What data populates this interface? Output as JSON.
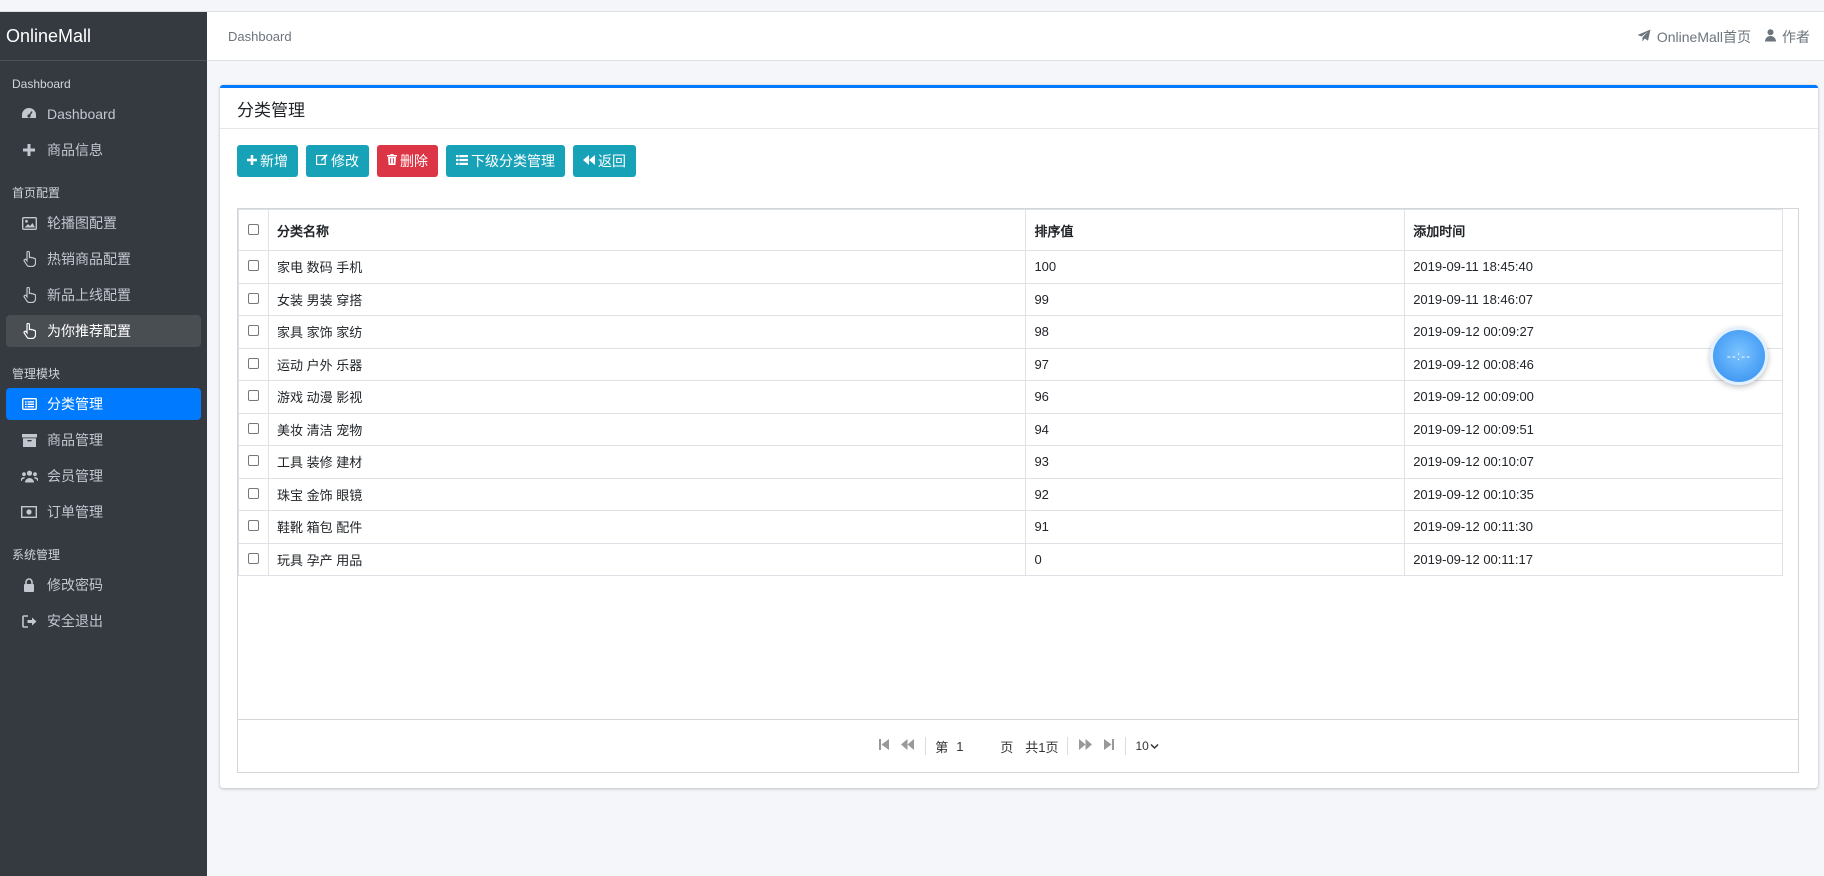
{
  "brand": "OnlineMall",
  "sidebar": {
    "sections": [
      {
        "header": "Dashboard",
        "items": [
          {
            "label": "Dashboard",
            "icon": "dashboard-icon"
          },
          {
            "label": "商品信息",
            "icon": "plus-icon"
          }
        ]
      },
      {
        "header": "首页配置",
        "items": [
          {
            "label": "轮播图配置",
            "icon": "image-icon"
          },
          {
            "label": "热销商品配置",
            "icon": "hand-pointer-icon"
          },
          {
            "label": "新品上线配置",
            "icon": "hand-pointer-icon"
          },
          {
            "label": "为你推荐配置",
            "icon": "hand-pointer-icon"
          }
        ]
      },
      {
        "header": "管理模块",
        "items": [
          {
            "label": "分类管理",
            "icon": "list-alt-icon"
          },
          {
            "label": "商品管理",
            "icon": "archive-icon"
          },
          {
            "label": "会员管理",
            "icon": "users-icon"
          },
          {
            "label": "订单管理",
            "icon": "money-icon"
          }
        ]
      },
      {
        "header": "系统管理",
        "items": [
          {
            "label": "修改密码",
            "icon": "lock-icon"
          },
          {
            "label": "安全退出",
            "icon": "sign-out-icon"
          }
        ]
      }
    ]
  },
  "header": {
    "breadcrumb": "Dashboard",
    "home_link": "OnlineMall首页",
    "author_link": "作者"
  },
  "card": {
    "title": "分类管理",
    "buttons": {
      "add": "新增",
      "edit": "修改",
      "delete": "删除",
      "sub": "下级分类管理",
      "back": "返回"
    }
  },
  "table": {
    "columns": [
      "分类名称",
      "排序值",
      "添加时间"
    ],
    "rows": [
      [
        "家电 数码 手机",
        "100",
        "2019-09-11 18:45:40"
      ],
      [
        "女装 男装 穿搭",
        "99",
        "2019-09-11 18:46:07"
      ],
      [
        "家具 家饰 家纺",
        "98",
        "2019-09-12 00:09:27"
      ],
      [
        "运动 户外 乐器",
        "97",
        "2019-09-12 00:08:46"
      ],
      [
        "游戏 动漫 影视",
        "96",
        "2019-09-12 00:09:00"
      ],
      [
        "美妆 清洁 宠物",
        "94",
        "2019-09-12 00:09:51"
      ],
      [
        "工具 装修 建材",
        "93",
        "2019-09-12 00:10:07"
      ],
      [
        "珠宝 金饰 眼镜",
        "92",
        "2019-09-12 00:10:35"
      ],
      [
        "鞋靴 箱包 配件",
        "91",
        "2019-09-12 00:11:30"
      ],
      [
        "玩具 孕产 用品",
        "0",
        "2019-09-12 00:11:17"
      ]
    ]
  },
  "pager": {
    "page_prefix": "第",
    "page_value": "1",
    "page_suffix": "页",
    "total": "共1页",
    "page_size": "10"
  },
  "widget_text": "--:--"
}
